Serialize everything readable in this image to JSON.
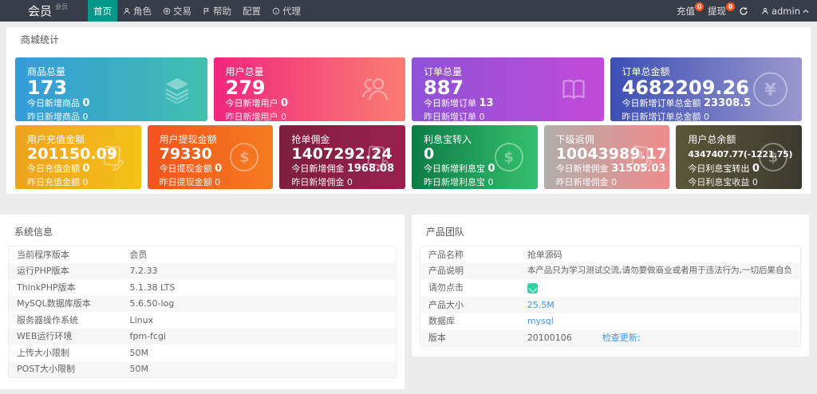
{
  "navbar": {
    "brand": "会员",
    "brand_sup": "会员",
    "items": [
      {
        "label": "首页"
      },
      {
        "label": "角色"
      },
      {
        "label": "交易"
      },
      {
        "label": "帮助"
      },
      {
        "label": "配置"
      },
      {
        "label": "代理"
      }
    ],
    "recharge_label": "充值",
    "recharge_badge": "0",
    "withdraw_label": "提现",
    "withdraw_badge": "0",
    "username": "admin",
    "active_color": "#009688",
    "badge_color": "#FF5722"
  },
  "stats": {
    "title": "商城统计",
    "cards_row1": [
      {
        "title": "商品总量",
        "value": "173",
        "today_label": "今日新增商品",
        "today_value": "0",
        "yest_label": "昨日新增商品",
        "yest_value": "0",
        "colors": [
          "#359bdb",
          "#40c0ae"
        ],
        "icon": "layers"
      },
      {
        "title": "用户总量",
        "value": "279",
        "today_label": "今日新增用户",
        "today_value": "0",
        "yest_label": "昨日新增用户",
        "yest_value": "0",
        "colors": [
          "#f1267e",
          "#f97d72"
        ],
        "icon": "users"
      },
      {
        "title": "订单总量",
        "value": "887",
        "today_label": "今日新增订单",
        "today_value": "13",
        "yest_label": "昨日新增订单",
        "yest_value": "0",
        "colors": [
          "#8d52d6",
          "#c24ad8"
        ],
        "icon": "book"
      },
      {
        "title": "订单总金额",
        "value": "4682209.26",
        "today_label": "今日新增订单总金额",
        "today_value": "23308.5",
        "yest_label": "昨日新增订单总金额",
        "yest_value": "0",
        "colors": [
          "#3c4fb5",
          "#9a98cd"
        ],
        "icon": "yen-circle"
      }
    ],
    "cards_row2": [
      {
        "title": "用户充值金额",
        "value": "201150.09",
        "today_label": "今日充值金额",
        "today_value": "0",
        "yest_label": "昨日充值金额",
        "yest_value": "0",
        "colors": [
          "#eea31e",
          "#f4c117"
        ],
        "icon": "doc-question"
      },
      {
        "title": "用户提现金额",
        "value": "79330",
        "today_label": "今日提现金额",
        "today_value": "0",
        "yest_label": "昨日提现金额",
        "yest_value": "0",
        "colors": [
          "#f4531d",
          "#f57c20"
        ],
        "icon": "dollar-circle"
      },
      {
        "title": "抢单佣金",
        "value": "1407292.24",
        "today_label": "今日新增佣金",
        "today_value": "1968.08",
        "yest_label": "昨日新增佣金",
        "yest_value": "0",
        "colors": [
          "#7e1f3e",
          "#99204e"
        ],
        "icon": "doc-question"
      },
      {
        "title": "利息宝转入",
        "value": "0",
        "today_label": "今日新增利息宝",
        "today_value": "0",
        "yest_label": "昨日新增利息宝",
        "yest_value": "0",
        "colors": [
          "#0d7c45",
          "#35c06f"
        ],
        "icon": "dollar-circle"
      },
      {
        "title": "下级返佣",
        "value": "10043989.17",
        "today_label": "今日新增佣金",
        "today_value": "31505.03",
        "yest_label": "昨日新增佣金",
        "yest_value": "0",
        "colors": [
          "#b0adaa",
          "#f18b8b"
        ],
        "icon": "doc-question"
      },
      {
        "title": "用户总余额",
        "value": "4347407.77(-1221.75)",
        "today_label": "今日利息宝转出",
        "today_value": "0",
        "yest_label": "今日利息宝收益",
        "yest_value": "0",
        "colors": [
          "#5a5738",
          "#3c3a30"
        ],
        "icon": "dollar-circle"
      }
    ]
  },
  "system_info": {
    "title": "系统信息",
    "rows": [
      {
        "label": "当前程序版本",
        "value": "会员"
      },
      {
        "label": "运行PHP版本",
        "value": "7.2.33"
      },
      {
        "label": "ThinkPHP版本",
        "value": "5.1.38 LTS"
      },
      {
        "label": "MySQL数据库版本",
        "value": "5.6.50-log"
      },
      {
        "label": "服务器操作系统",
        "value": "Linux"
      },
      {
        "label": "WEB运行环境",
        "value": "fpm-fcgi"
      },
      {
        "label": "上传大小限制",
        "value": "50M"
      },
      {
        "label": "POST大小限制",
        "value": "50M"
      }
    ]
  },
  "product_team": {
    "title": "产品团队",
    "rows": [
      {
        "label": "产品名称",
        "value": "抢单源码"
      },
      {
        "label": "产品说明",
        "value": "本产品只为学习测试交流,请勿要做商业或者用于违法行为,一切后果自负"
      },
      {
        "label": "请勿点击",
        "value": ""
      },
      {
        "label": "产品大小",
        "value": "25.5M"
      },
      {
        "label": "数据库",
        "value": "mysql"
      },
      {
        "label": "版本",
        "value": "20100106",
        "link": "检查更新;"
      }
    ],
    "icon_color": "#2ed3a7",
    "link_color": "#4295f5"
  }
}
